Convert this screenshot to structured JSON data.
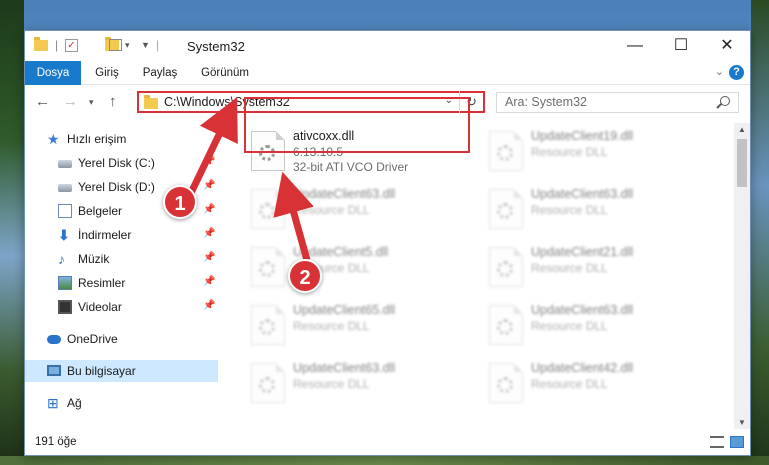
{
  "window": {
    "title": "System32",
    "controls": {
      "minimize": "—",
      "maximize": "☐",
      "close": "✕"
    }
  },
  "ribbon": {
    "tabs": [
      "Dosya",
      "Giriş",
      "Paylaş",
      "Görünüm"
    ],
    "help": "?"
  },
  "nav": {
    "address": "C:\\Windows\\System32",
    "search_placeholder": "Ara: System32"
  },
  "sidebar": {
    "items": [
      {
        "label": "Hızlı erişim",
        "icon": "star-icon"
      },
      {
        "label": "Yerel Disk (C:)",
        "icon": "disk-icon",
        "pinned": true
      },
      {
        "label": "Yerel Disk (D:)",
        "icon": "disk-icon",
        "pinned": true
      },
      {
        "label": "Belgeler",
        "icon": "documents-icon",
        "pinned": true
      },
      {
        "label": "İndirmeler",
        "icon": "downloads-icon",
        "pinned": true
      },
      {
        "label": "Müzik",
        "icon": "music-icon",
        "pinned": true
      },
      {
        "label": "Resimler",
        "icon": "pictures-icon",
        "pinned": true
      },
      {
        "label": "Videolar",
        "icon": "videos-icon",
        "pinned": true
      },
      {
        "label": "OneDrive",
        "icon": "onedrive-icon"
      },
      {
        "label": "Bu bilgisayar",
        "icon": "this-pc-icon",
        "selected": true
      },
      {
        "label": "Ağ",
        "icon": "network-icon"
      }
    ]
  },
  "files": {
    "highlighted": {
      "name": "ativcoxx.dll",
      "version": "6.13.10.5",
      "description": "32-bit ATI VCO Driver"
    },
    "items": [
      {
        "name": "UpdateClient19.dll",
        "type": "Resource DLL"
      },
      {
        "name": "UpdateClient63.dll",
        "type": "Resource DLL"
      },
      {
        "name": "UpdateClient63.dll",
        "type": "Resource DLL"
      },
      {
        "name": "UpdateClient5.dll",
        "type": "Resource DLL"
      },
      {
        "name": "UpdateClient21.dll",
        "type": "Resource DLL"
      },
      {
        "name": "UpdateClient65.dll",
        "type": "Resource DLL"
      },
      {
        "name": "UpdateClient63.dll",
        "type": "Resource DLL"
      },
      {
        "name": "UpdateClient63.dll",
        "type": "Resource DLL"
      },
      {
        "name": "UpdateClient42.dll",
        "type": "Resource DLL"
      }
    ]
  },
  "status": {
    "count": "191 öğe"
  },
  "annotations": {
    "marker1": "1",
    "marker2": "2",
    "color": "#d93236"
  }
}
